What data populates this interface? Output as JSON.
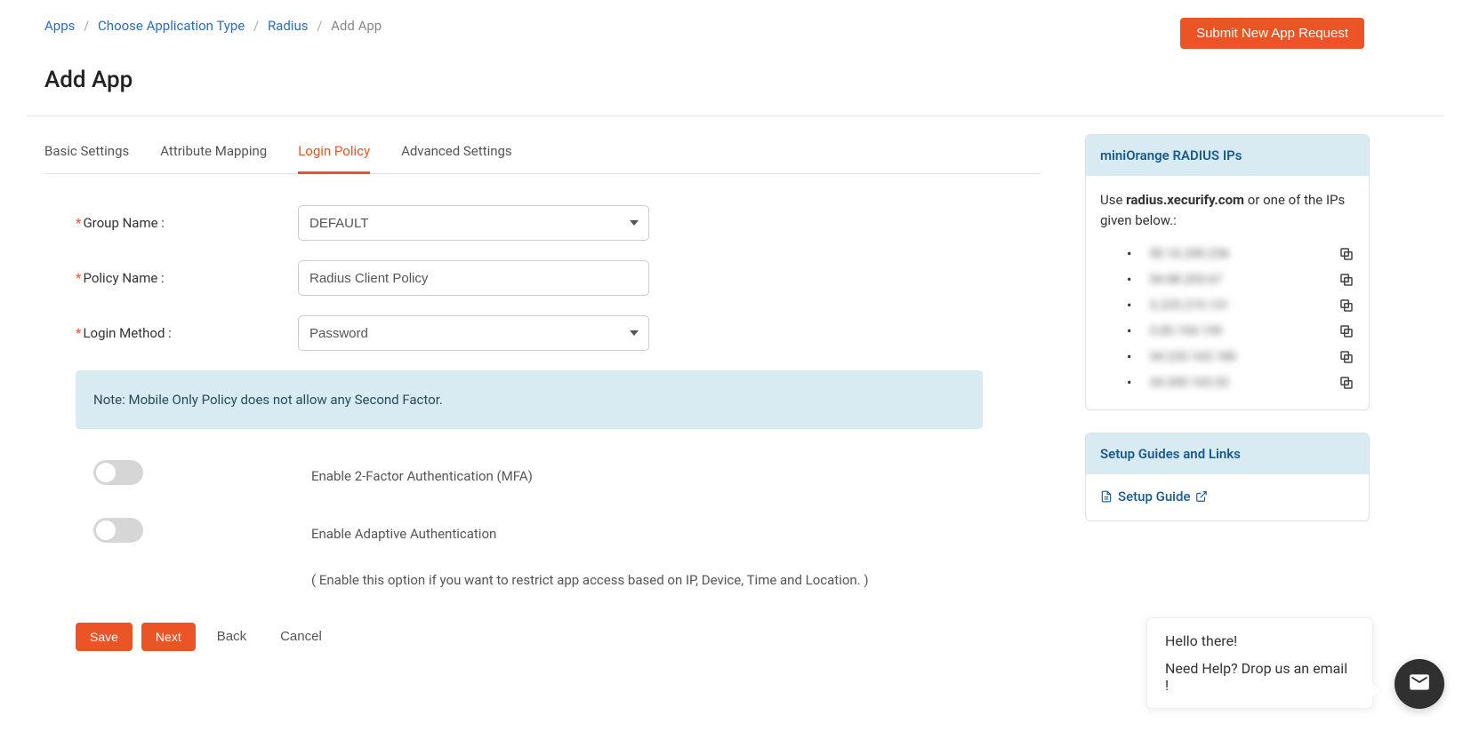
{
  "breadcrumb": {
    "items": [
      "Apps",
      "Choose Application Type",
      "Radius"
    ],
    "current": "Add App"
  },
  "header": {
    "submit_button": "Submit New App Request",
    "title": "Add App"
  },
  "tabs": [
    {
      "label": "Basic Settings",
      "active": false
    },
    {
      "label": "Attribute Mapping",
      "active": false
    },
    {
      "label": "Login Policy",
      "active": true
    },
    {
      "label": "Advanced Settings",
      "active": false
    }
  ],
  "form": {
    "group_name": {
      "label": "Group Name :",
      "value": "DEFAULT"
    },
    "policy_name": {
      "label": "Policy Name :",
      "value": "Radius Client Policy"
    },
    "login_method": {
      "label": "Login Method :",
      "value": "Password"
    },
    "note": "Note: Mobile Only Policy does not allow any Second Factor.",
    "toggle_mfa": {
      "label": "Enable 2-Factor Authentication (MFA)"
    },
    "toggle_adaptive": {
      "label": "Enable Adaptive Authentication",
      "help": "( Enable this option if you want to restrict app access based on IP, Device, Time and Location. )"
    }
  },
  "actions": {
    "save": "Save",
    "next": "Next",
    "back": "Back",
    "cancel": "Cancel"
  },
  "side": {
    "radius_panel": {
      "title": "miniOrange RADIUS IPs",
      "intro_pre": "Use ",
      "intro_bold": "radius.xecurify.com",
      "intro_post": " or one of the IPs given below.:",
      "ips": [
        "50.16.200.236",
        "54.88.203.67",
        "3.225.215.131",
        "3.85.104.159",
        "34.233.165.180",
        "34.200.165.52"
      ]
    },
    "guides_panel": {
      "title": "Setup Guides and Links",
      "link": "Setup Guide"
    }
  },
  "chat": {
    "line1": "Hello there!",
    "line2": "Need Help? Drop us an email !"
  }
}
